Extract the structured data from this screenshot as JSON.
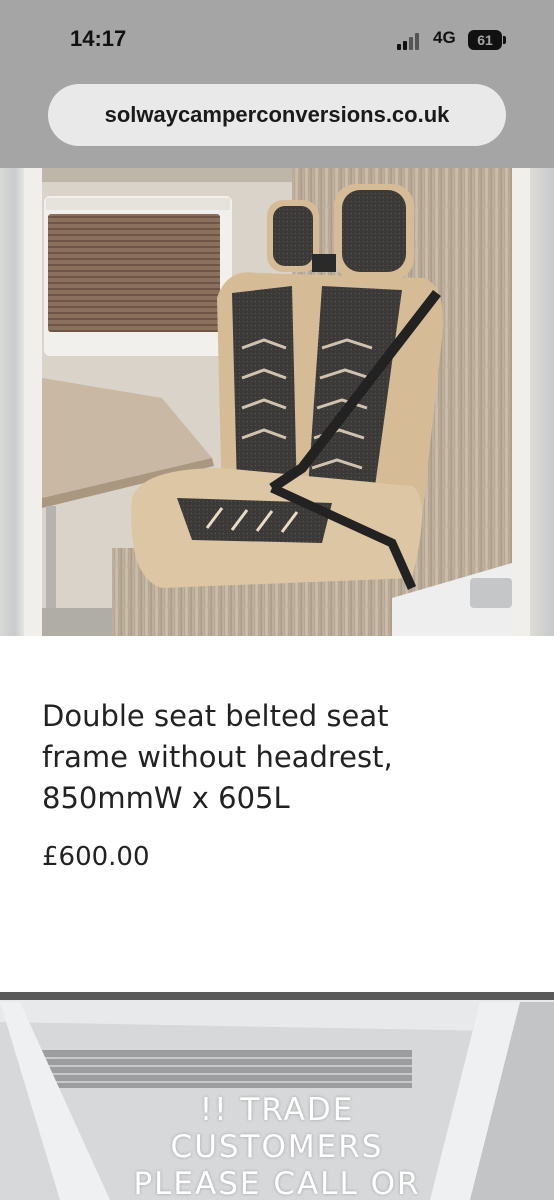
{
  "status_bar": {
    "time": "14:17",
    "network": "4G",
    "battery": "61"
  },
  "browser": {
    "url": "solwaycamperconversions.co.uk"
  },
  "product": {
    "image_alt": "Double seat with belted frame in campervan",
    "title": "Double seat belted seat frame without headrest, 850mmW x 605L",
    "price": "£600.00"
  },
  "banner": {
    "lines": [
      "!! TRADE",
      "CUSTOMERS",
      "PLEASE CALL OR"
    ]
  },
  "colors": {
    "status_bg": "#a5a5a5",
    "url_pill": "#e9e9e9",
    "text": "#222222"
  }
}
